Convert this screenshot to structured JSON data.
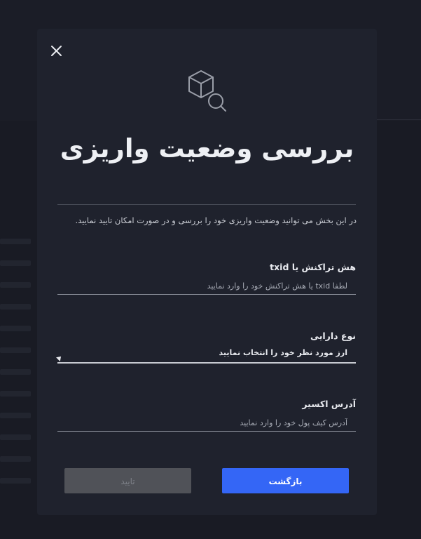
{
  "modal": {
    "title": "بررسی وضعیت واریزی",
    "description": "در این بخش می توانید وضعیت واریزی خود را بررسی و در صورت امکان تایید نمایید.",
    "fields": {
      "txid": {
        "label": "هش تراکنش یا txid",
        "placeholder": "لطفا txid یا هش تراکنش خود را وارد نمایید"
      },
      "asset": {
        "label": "نوع دارایی",
        "selected": "ارز مورد نظر خود را انتخاب نمایید"
      },
      "address": {
        "label": "آدرس اکسیر",
        "placeholder": "آدرس کیف پول خود را وارد نمایید"
      }
    },
    "buttons": {
      "back": "بازگشت",
      "confirm": "تایید"
    },
    "icons": {
      "close": "close-icon",
      "header": "box-search-icon"
    }
  },
  "colors": {
    "primary": "#3466f6",
    "disabled": "#505258",
    "modal_bg": "#1f222d"
  }
}
